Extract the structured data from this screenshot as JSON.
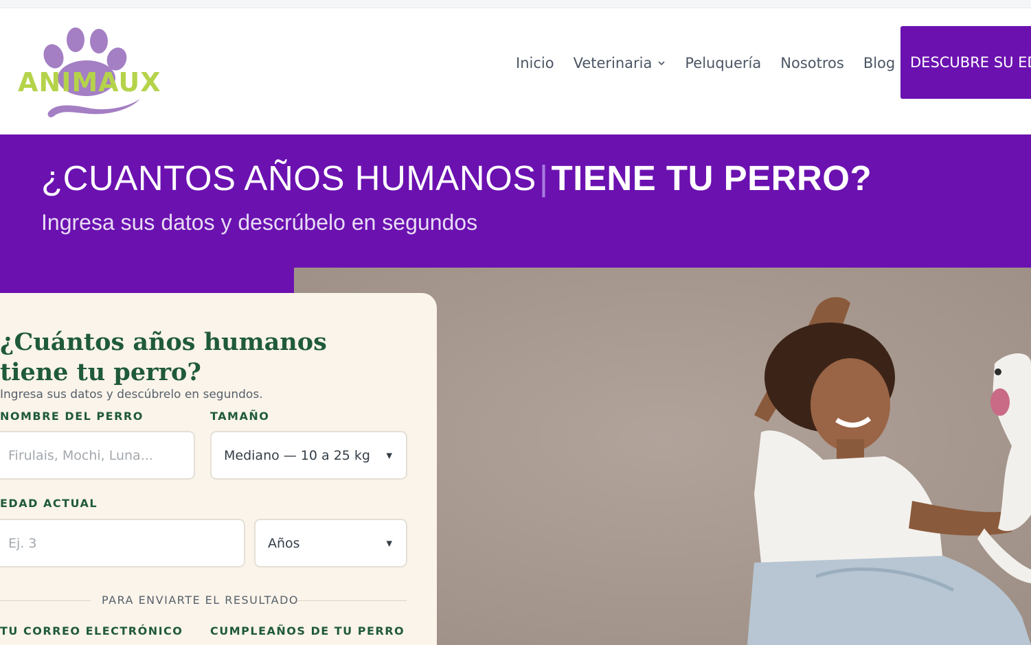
{
  "header": {
    "logo_text": "ANIMAUX",
    "nav": [
      {
        "label": "Inicio"
      },
      {
        "label": "Veterinaria",
        "has_dropdown": true,
        "icon": "chevron-down-icon"
      },
      {
        "label": "Peluquería"
      },
      {
        "label": "Nosotros"
      },
      {
        "label": "Blog"
      }
    ],
    "cta_label": "DESCUBRE SU ED"
  },
  "hero": {
    "title_part1": "¿CUANTOS AÑOS HUMANOS",
    "title_divider": "|",
    "title_part2": "TIENE TU PERRO?",
    "subtitle": "Ingresa sus datos y descrúbelo en segundos"
  },
  "form": {
    "title": "¿Cuántos años humanos tiene tu perro?",
    "subtitle": "Ingresa sus datos y descúbrelo en segundos.",
    "dog_name_label": "NOMBRE DEL PERRO",
    "dog_name_placeholder": "Firulais, Mochi, Luna...",
    "size_label": "TAMAÑO",
    "size_value": "Mediano — 10 a 25 kg",
    "age_label": "EDAD ACTUAL",
    "age_placeholder": "Ej. 3",
    "age_unit_value": "Años",
    "section_divider": "PARA ENVIARTE EL RESULTADO",
    "email_label": "TU CORREO ELECTRÓNICO",
    "birthday_label": "CUMPLEAÑOS DE TU PERRO"
  },
  "colors": {
    "brand_purple": "#6b11b0",
    "logo_green": "#b5d34a",
    "logo_lilac": "#a47fc4",
    "form_green": "#1f5a3b",
    "card_bg": "#fbf4ea"
  }
}
